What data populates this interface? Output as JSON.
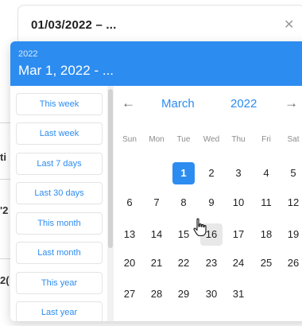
{
  "date_input": {
    "value": "01/03/2022 – ...",
    "clear_icon": "close-icon"
  },
  "background": {
    "fragments": [
      "ti",
      "'2",
      "2("
    ]
  },
  "picker": {
    "header_year": "2022",
    "header_range": "Mar 1, 2022 - ...",
    "presets": [
      "This week",
      "Last week",
      "Last 7 days",
      "Last 30 days",
      "This month",
      "Last month",
      "This year",
      "Last year"
    ],
    "month_label": "March",
    "year_label": "2022",
    "prev_icon": "arrow-left-icon",
    "next_icon": "arrow-right-icon",
    "weekdays": [
      "Sun",
      "Mon",
      "Tue",
      "Wed",
      "Thu",
      "Fri",
      "Sat"
    ],
    "weeks": [
      [
        "",
        "",
        "1",
        "2",
        "3",
        "4",
        "5"
      ],
      [
        "6",
        "7",
        "8",
        "9",
        "10",
        "11",
        "12"
      ],
      [
        "13",
        "14",
        "15",
        "16",
        "17",
        "18",
        "19"
      ],
      [
        "20",
        "21",
        "22",
        "23",
        "24",
        "25",
        "26"
      ],
      [
        "27",
        "28",
        "29",
        "30",
        "31",
        "",
        ""
      ]
    ],
    "selected_day": "1",
    "today_day": "16",
    "accent_color": "#2d8cf0"
  },
  "cursor": "hand-pointer-icon"
}
